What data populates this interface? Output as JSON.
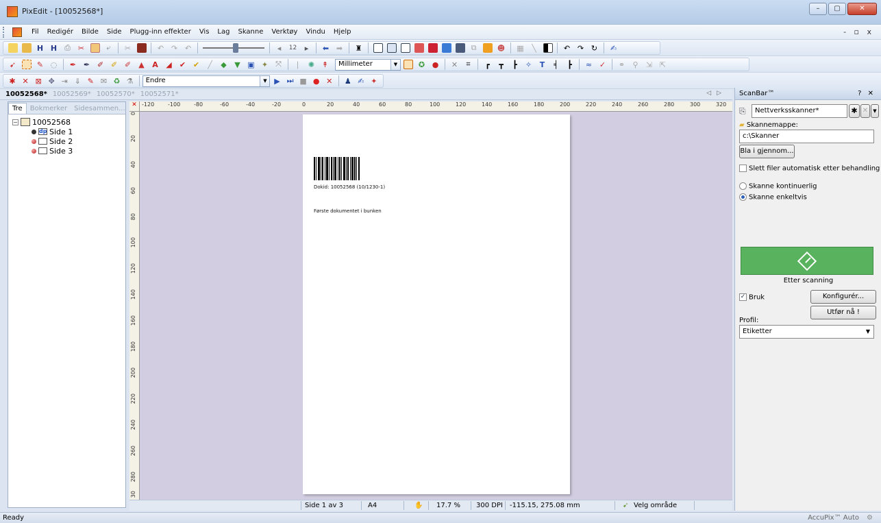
{
  "window": {
    "title": "PixEdit - [10052568*]",
    "controls": [
      "–",
      "▢",
      "✕"
    ]
  },
  "menu": {
    "items": [
      "Fil",
      "Redigér",
      "Bilde",
      "Side",
      "Plugg-inn effekter",
      "Vis",
      "Lag",
      "Skanne",
      "Verktøy",
      "Vindu",
      "Hjelp"
    ],
    "right": "- ▫ x"
  },
  "toolbars": {
    "unit_combo": "Millimeter",
    "zoom_value": "12",
    "edit_combo": "Endre"
  },
  "document_tabs": [
    "10052568*",
    "10052569*",
    "10052570*",
    "10052571*"
  ],
  "left_pane": {
    "tabs": [
      "Tre",
      "Bokmerker",
      "Sidesammen..."
    ],
    "root": "10052568",
    "pages": [
      "Side 1",
      "Side 2",
      "Side 3"
    ]
  },
  "rulers": {
    "horizontal": [
      "-120",
      "-100",
      "-80",
      "-60",
      "-40",
      "-20",
      "0",
      "20",
      "40",
      "60",
      "80",
      "100",
      "120",
      "140",
      "160",
      "180",
      "200",
      "220",
      "240",
      "260",
      "280",
      "300",
      "320"
    ],
    "vertical": [
      "0",
      "20",
      "40",
      "60",
      "80",
      "100",
      "120",
      "140",
      "160",
      "180",
      "200",
      "220",
      "240",
      "260",
      "280",
      "30"
    ]
  },
  "page": {
    "dokid": "Dokid: 10052568 (10/1230-1)",
    "text": "Første dokumentet i bunken"
  },
  "canvas_status": {
    "page": "Side 1 av 3",
    "format": "A4",
    "zoom": "17.7 %",
    "dpi": "300 DPI",
    "coords": "-115.15, 275.08 mm",
    "tool": "Velg område"
  },
  "status": {
    "text": "Ready",
    "right": "AccuPix™ Auto"
  },
  "scanbar": {
    "title": "ScanBar™",
    "controls": "? ✕",
    "scanner": "Nettverksskanner*",
    "folder_label": "Skannemappe:",
    "folder_value": "c:\\Skanner",
    "browse": "Bla i gjennom...",
    "auto_delete": "Slett filer automatisk etter behandling",
    "continuous": "Skanne kontinuerlig",
    "single": "Skanne enkeltvis",
    "after_scan": "Etter scanning",
    "use": "Bruk",
    "configure": "Konfigurér...",
    "run_now": "Utfør nå !",
    "profile_label": "Profil:",
    "profile_value": "Etiketter"
  },
  "colors": {
    "scan_button": "#59b25e",
    "canvas_bg": "#d2cde0"
  }
}
